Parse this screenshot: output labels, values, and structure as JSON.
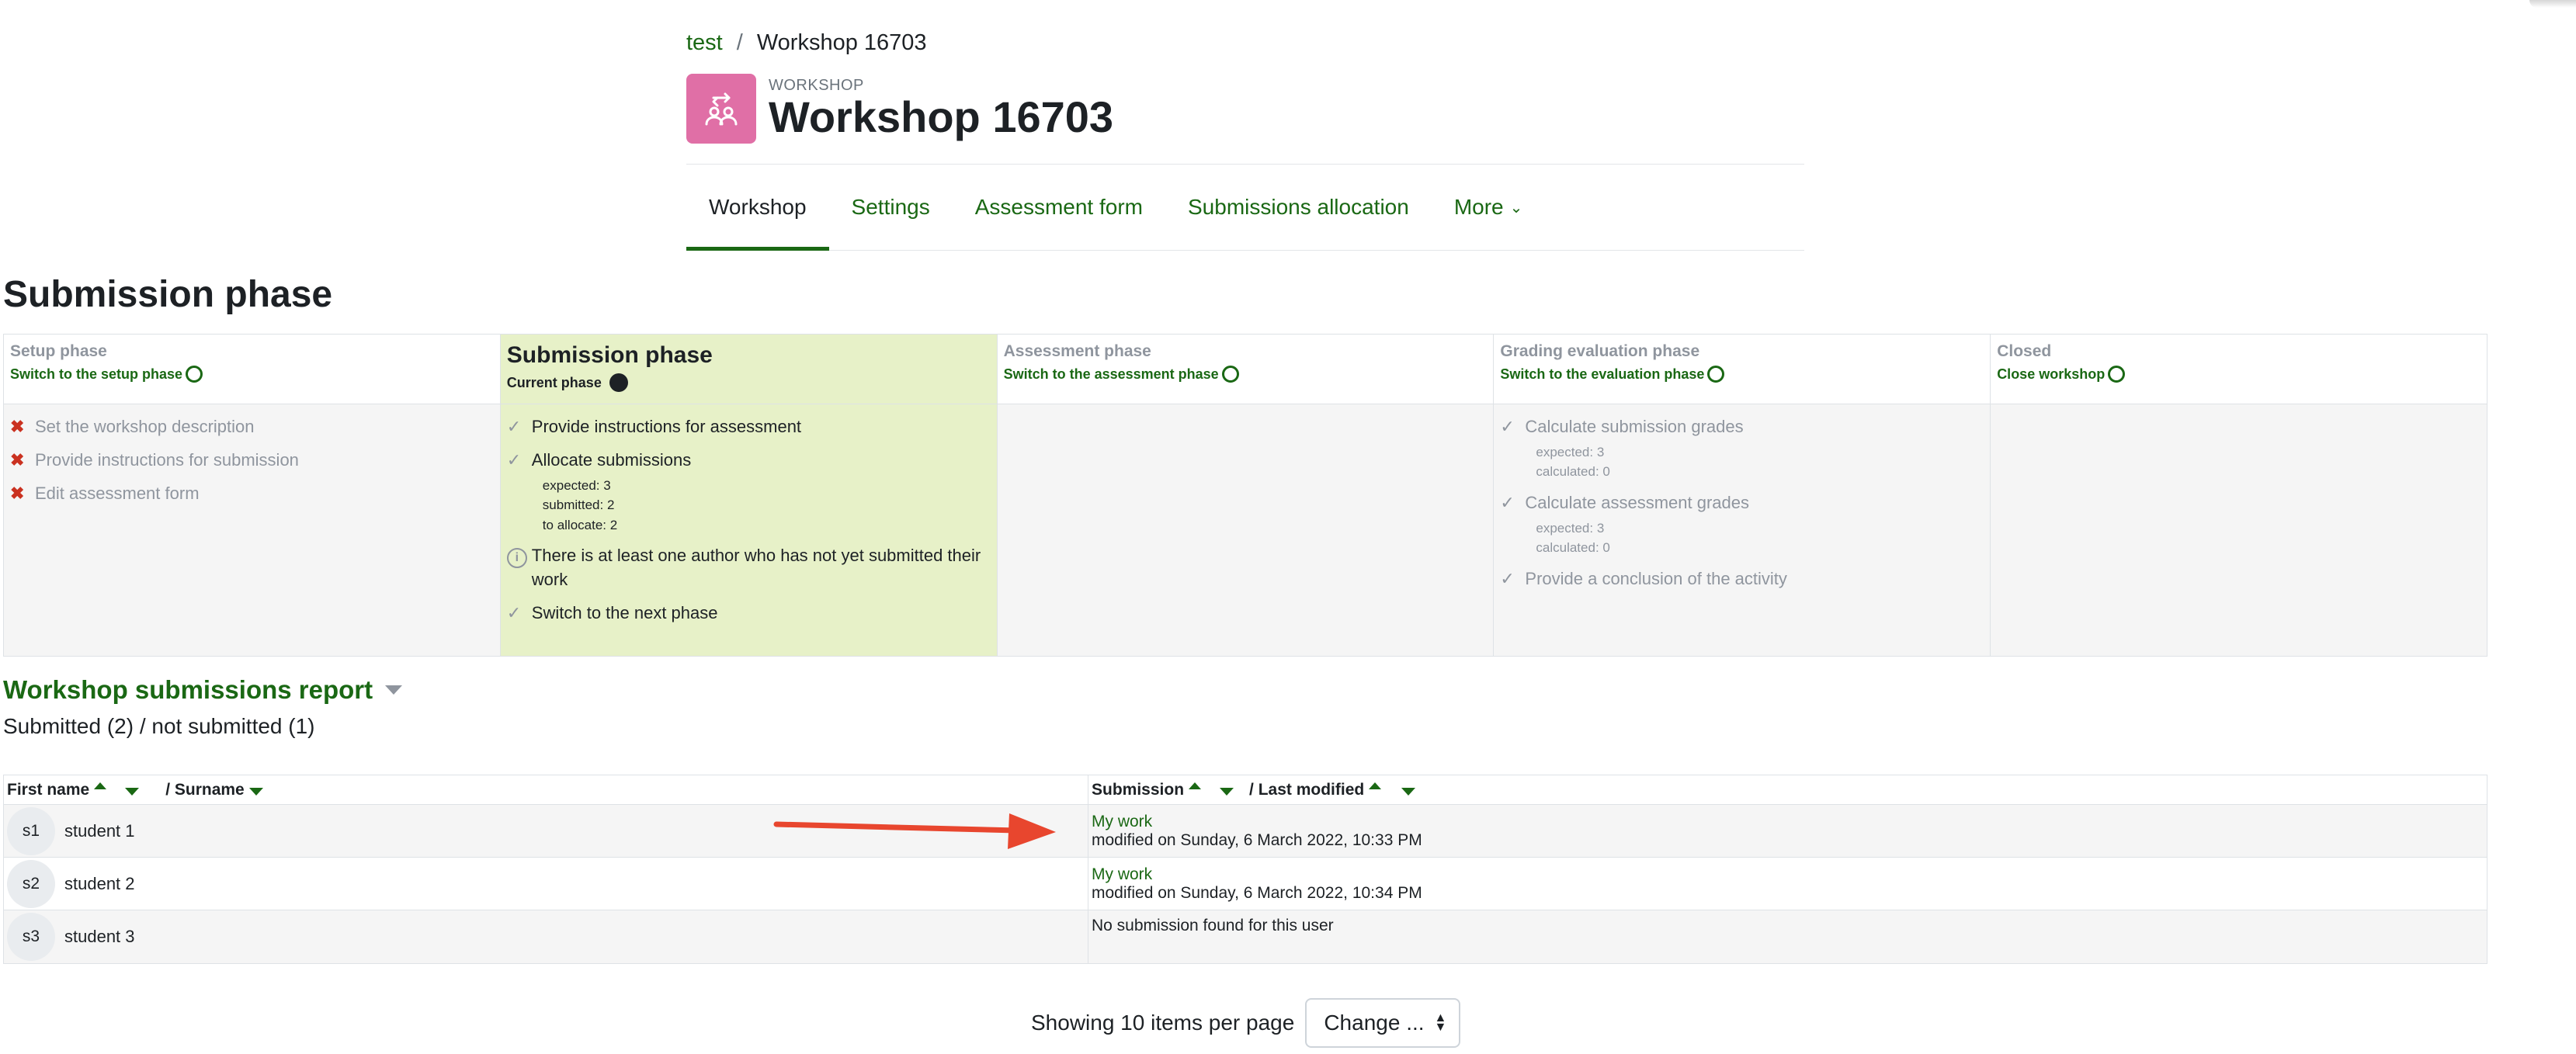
{
  "breadcrumb": {
    "course": "test",
    "separator": "/",
    "current": "Workshop 16703"
  },
  "activity": {
    "kicker": "WORKSHOP",
    "title": "Workshop 16703",
    "icon": "workshop-icon",
    "icon_color": "#e06fa6"
  },
  "tabs": [
    {
      "label": "Workshop",
      "active": true
    },
    {
      "label": "Settings"
    },
    {
      "label": "Assessment form"
    },
    {
      "label": "Submissions allocation"
    },
    {
      "label": "More"
    }
  ],
  "phase_heading": "Submission phase",
  "phases": [
    {
      "name": "Setup phase",
      "action": "Switch to the setup phase",
      "tasks": [
        {
          "icon": "x-icon",
          "text": "Set the workshop description"
        },
        {
          "icon": "x-icon",
          "text": "Provide instructions for submission"
        },
        {
          "icon": "x-icon",
          "text": "Edit assessment form"
        }
      ]
    },
    {
      "name": "Submission phase",
      "action": "Current phase",
      "tasks": [
        {
          "icon": "check-icon",
          "text": "Provide instructions for assessment"
        },
        {
          "icon": "check-icon",
          "text": "Allocate submissions",
          "details": [
            "expected: 3",
            "submitted: 2",
            "to allocate: 2"
          ]
        },
        {
          "icon": "info-icon",
          "text": "There is at least one author who has not yet submitted their work"
        },
        {
          "icon": "check-icon",
          "text": "Switch to the next phase"
        }
      ]
    },
    {
      "name": "Assessment phase",
      "action": "Switch to the assessment phase",
      "tasks": []
    },
    {
      "name": "Grading evaluation phase",
      "action": "Switch to the evaluation phase",
      "tasks": [
        {
          "icon": "check-icon",
          "text": "Calculate submission grades",
          "details": [
            "expected: 3",
            "calculated: 0"
          ]
        },
        {
          "icon": "check-icon",
          "text": "Calculate assessment grades",
          "details": [
            "expected: 3",
            "calculated: 0"
          ]
        },
        {
          "icon": "check-icon",
          "text": "Provide a conclusion of the activity"
        }
      ]
    },
    {
      "name": "Closed",
      "action": "Close workshop",
      "tasks": []
    }
  ],
  "report": {
    "title": "Workshop submissions report",
    "summary": "Submitted (2) / not submitted (1)",
    "columns": {
      "first_name": "First name",
      "surname": "/ Surname",
      "submission": "Submission",
      "last_modified": "/ Last modified"
    },
    "rows": [
      {
        "initials": "s1",
        "name": "student 1",
        "link": "My work",
        "modified": "modified on Sunday, 6 March 2022, 10:33 PM"
      },
      {
        "initials": "s2",
        "name": "student 2",
        "link": "My work",
        "modified": "modified on Sunday, 6 March 2022, 10:34 PM"
      },
      {
        "initials": "s3",
        "name": "student 3",
        "no_submission": "No submission found for this user"
      }
    ]
  },
  "pager": {
    "label": "Showing 10 items per page",
    "select_value": "Change ..."
  },
  "colors": {
    "link": "#1a6814",
    "current_phase_bg": "#e7f1c8",
    "arrow": "#e8462e"
  }
}
